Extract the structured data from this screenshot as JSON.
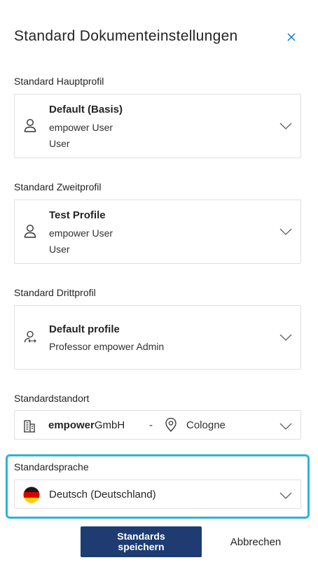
{
  "panel": {
    "title": "Standard Dokumenteinstellungen"
  },
  "primary_profile": {
    "label": "Standard Hauptprofil",
    "name": "Default (Basis)",
    "user": "empower User",
    "role": "User"
  },
  "secondary_profile": {
    "label": "Standard Zweitprofil",
    "name": "Test Profile",
    "user": "empower User",
    "role": "User"
  },
  "tertiary_profile": {
    "label": "Standard Drittprofil",
    "name": "Default profile",
    "user": "Professor empower Admin"
  },
  "location": {
    "label": "Standardstandort",
    "company_bold": "empower",
    "company_rest": "GmbH",
    "separator": "-",
    "city": "Cologne"
  },
  "language": {
    "label": "Standardsprache",
    "value": "Deutsch (Deutschland)"
  },
  "actions": {
    "save_label": "Standards speichern",
    "cancel_label": "Abbrechen"
  },
  "colors": {
    "accent": "#1e3c72",
    "focus": "#2cb5d5",
    "close_icon": "#0078d4"
  }
}
